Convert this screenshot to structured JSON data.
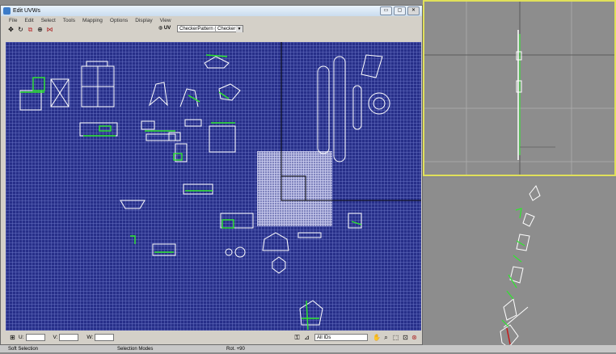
{
  "window": {
    "title": "Edit UVWs",
    "buttons": {
      "minimize": "▭",
      "maximize": "▢",
      "close": "✕"
    }
  },
  "menu": [
    "File",
    "Edit",
    "Select",
    "Tools",
    "Mapping",
    "Options",
    "Display",
    "View"
  ],
  "toolbar": {
    "uv_label": "UV",
    "texture_dropdown": "CheckerPattern  ( Checker )"
  },
  "bottom": {
    "u_label": "U:",
    "v_label": "V:",
    "w_label": "W:",
    "ids_dropdown": "All IDs"
  },
  "statusbar": {
    "left": "Soft Selection",
    "middle": "Selection Modes",
    "right": "Rot. +90"
  },
  "colors": {
    "uv_background": "#272f89",
    "uv_lines": "#ffffff",
    "uv_selected": "#2ee82e",
    "viewport_highlight": "#e0e05a"
  }
}
